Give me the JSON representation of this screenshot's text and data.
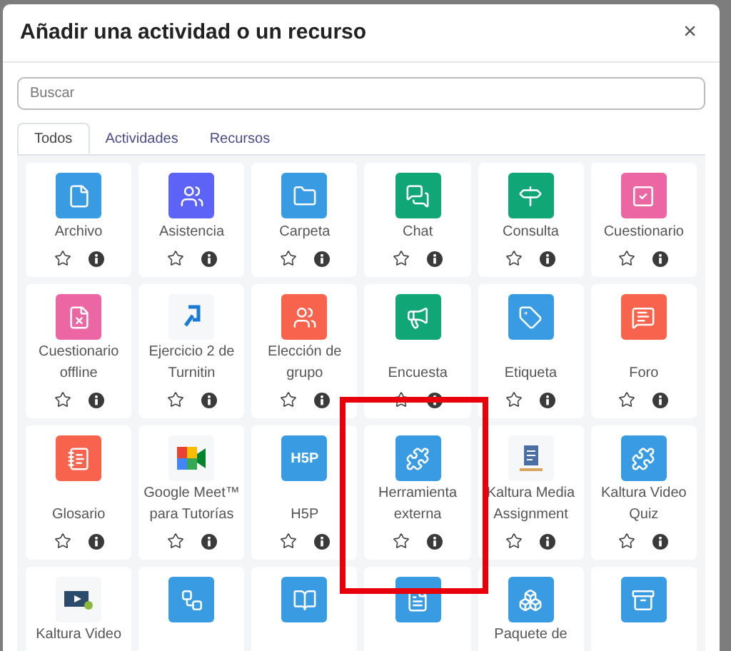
{
  "dialog": {
    "title": "Añadir una actividad o un recurso",
    "close": "×"
  },
  "search": {
    "placeholder": "Buscar"
  },
  "tabs": [
    {
      "label": "Todos",
      "selected": true
    },
    {
      "label": "Actividades",
      "selected": false
    },
    {
      "label": "Recursos",
      "selected": false
    }
  ],
  "items": [
    {
      "label": "Archivo",
      "color": "#399be2",
      "starred": false,
      "highlighted": false
    },
    {
      "label": "Asistencia",
      "color": "#5d63f6",
      "starred": false,
      "highlighted": false
    },
    {
      "label": "Carpeta",
      "color": "#399be2",
      "starred": false,
      "highlighted": false
    },
    {
      "label": "Chat",
      "color": "#11a676",
      "starred": false,
      "highlighted": false
    },
    {
      "label": "Consulta",
      "color": "#11a676",
      "starred": false,
      "highlighted": false
    },
    {
      "label": "Cuestionario",
      "color": "#eb66a2",
      "starred": false,
      "highlighted": false
    },
    {
      "label": "Cuestionario offline",
      "color": "#eb66a2",
      "starred": false,
      "highlighted": false
    },
    {
      "label": "Ejercicio 2 de Turnitin",
      "color": "#f5f7f9",
      "starred": false,
      "highlighted": false
    },
    {
      "label": "Elección de grupo",
      "color": "#f7634d",
      "starred": false,
      "highlighted": false
    },
    {
      "label": "Encuesta",
      "color": "#11a676",
      "starred": false,
      "highlighted": false
    },
    {
      "label": "Etiqueta",
      "color": "#399be2",
      "starred": false,
      "highlighted": false
    },
    {
      "label": "Foro",
      "color": "#f7634d",
      "starred": false,
      "highlighted": false
    },
    {
      "label": "Glosario",
      "color": "#f7634d",
      "starred": false,
      "highlighted": false
    },
    {
      "label": "Google Meet™ para Tutorías",
      "color": "#f5f7f9",
      "starred": false,
      "highlighted": false
    },
    {
      "label": "H5P",
      "logo_text": "H5P",
      "color": "#399be2",
      "starred": false,
      "highlighted": false
    },
    {
      "label": "Herramienta externa",
      "color": "#399be2",
      "starred": false,
      "highlighted": true
    },
    {
      "label": "Kaltura Media Assignment",
      "color": "#f5f7f9",
      "starred": false,
      "highlighted": false
    },
    {
      "label": "Kaltura Video Quiz",
      "color": "#399be2",
      "starred": false,
      "highlighted": false
    },
    {
      "label": "Kaltura Video",
      "color": "#f5f7f9"
    },
    {
      "color": "#399be2"
    },
    {
      "color": "#399be2"
    },
    {
      "color": "#399be2"
    },
    {
      "label": "Paquete de",
      "color": "#399be2"
    },
    {
      "color": "#399be2"
    }
  ]
}
